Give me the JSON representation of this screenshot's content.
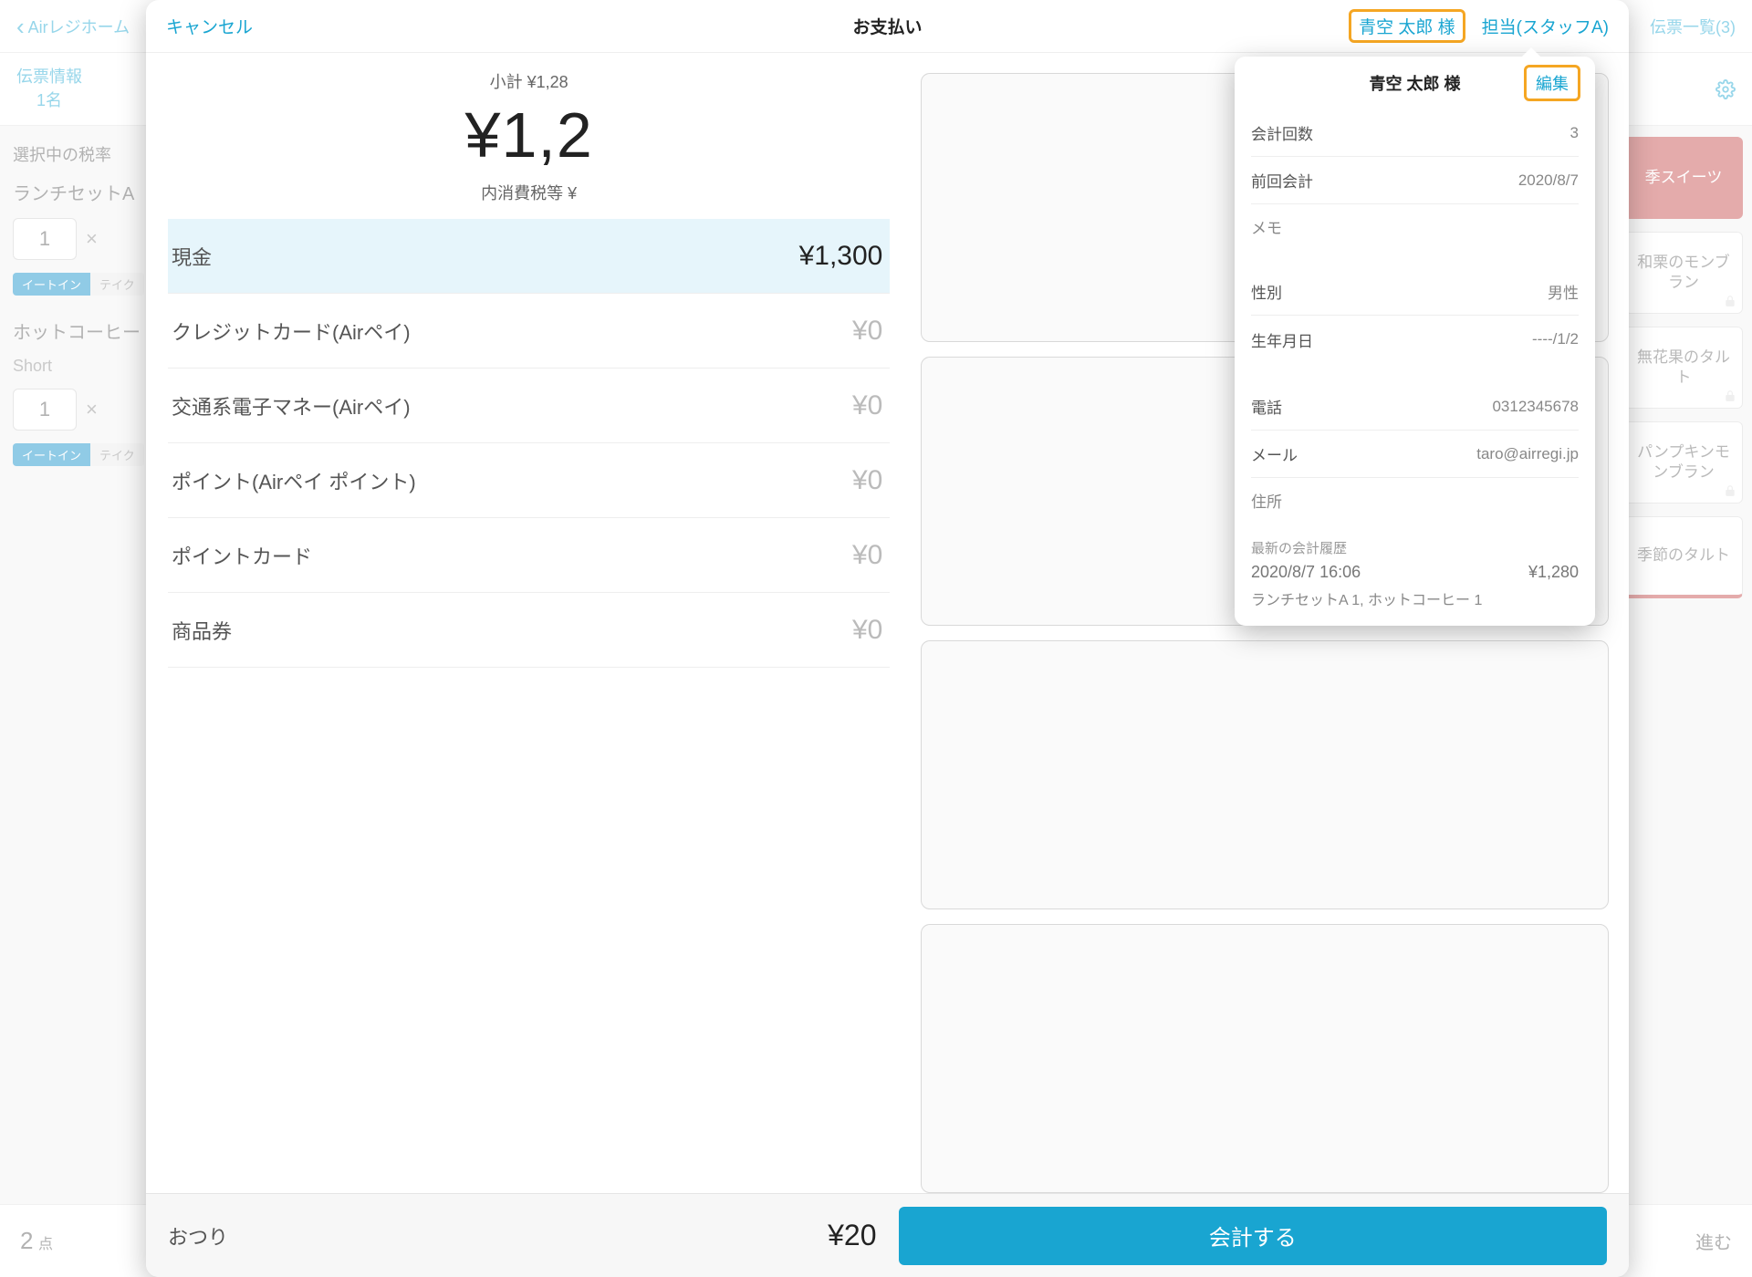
{
  "bg": {
    "back_label": "Airレジホーム",
    "ticket_list": "伝票一覧(3)",
    "ticket_info": "伝票情報",
    "ticket_people": "1名",
    "tax_label": "選択中の税率",
    "item1_name": "ランチセットA",
    "item1_qty": "1",
    "item1_x": "×",
    "item2_name": "ホットコーヒー",
    "item2_size": "Short",
    "item2_qty": "1",
    "item2_x": "×",
    "tag_eatin": "イートイン",
    "tag_take": "テイク",
    "foot_count_num": "2",
    "foot_count_unit": "点",
    "foot_next": "進む",
    "tiles": {
      "t1": "季スイーツ",
      "t2": "和栗のモンブラン",
      "t3": "無花果のタルト",
      "t4": "パンプキンモンブラン",
      "t5": "季節のタルト"
    }
  },
  "sheet": {
    "cancel": "キャンセル",
    "title": "お支払い",
    "customer_btn": "青空 太郎 様",
    "staff_btn": "担当(スタッフA)",
    "subtotal_label": "小計 ¥1,28",
    "grand_total": "¥1,2",
    "tax_label": "内消費税等 ¥",
    "methods": [
      {
        "label": "現金",
        "amount": "¥1,300",
        "selected": true
      },
      {
        "label": "クレジットカード(Airペイ)",
        "amount": "¥0",
        "selected": false
      },
      {
        "label": "交通系電子マネー(Airペイ)",
        "amount": "¥0",
        "selected": false
      },
      {
        "label": "ポイント(Airペイ ポイント)",
        "amount": "¥0",
        "selected": false
      },
      {
        "label": "ポイントカード",
        "amount": "¥0",
        "selected": false
      },
      {
        "label": "商品券",
        "amount": "¥0",
        "selected": false
      }
    ],
    "change_label": "おつり",
    "change_value": "¥20",
    "checkout": "会計する"
  },
  "popover": {
    "name": "青空 太郎 様",
    "edit": "編集",
    "rows1": [
      {
        "label": "会計回数",
        "value": "3"
      },
      {
        "label": "前回会計",
        "value": "2020/8/7"
      }
    ],
    "memo_label": "メモ",
    "rows2": [
      {
        "label": "性別",
        "value": "男性"
      },
      {
        "label": "生年月日",
        "value": "----/1/2"
      }
    ],
    "rows3": [
      {
        "label": "電話",
        "value": "0312345678"
      },
      {
        "label": "メール",
        "value": "taro@airregi.jp"
      }
    ],
    "address_label": "住所",
    "history_head": "最新の会計履歴",
    "history_time": "2020/8/7 16:06",
    "history_amount": "¥1,280",
    "history_detail": "ランチセットA 1, ホットコーヒー 1"
  }
}
